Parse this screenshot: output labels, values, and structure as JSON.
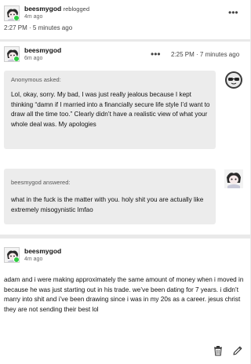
{
  "reblog_header": {
    "username": "beesmygod",
    "action": "reblogged",
    "relative_time": "4m ago",
    "timestamp": "2:27 PM · 5 minutes ago",
    "more_label": "•••"
  },
  "main_post": {
    "username": "beesmygod",
    "relative_time": "6m ago",
    "more_label": "•••",
    "timestamp": "2:25 PM · 7 minutes ago",
    "ask": {
      "asker": "Anonymous",
      "asked_label": "asked:",
      "text": "Lol, okay, sorry. My bad, I was just really jealous because I kept thinking “damn if I married into a financially secure life style I’d want to draw all the time too.” Clearly didn’t have a realistic view of what your whole deal was. My apologies"
    },
    "answer": {
      "answerer": "beesmygod",
      "answered_label": "answered:",
      "text": "what in the fuck is the matter with you. holy shit you are actually like extremely misogynistic lmfao"
    }
  },
  "reply_post": {
    "username": "beesmygod",
    "relative_time": "4m ago",
    "text": "adam and i were making approximately the same amount of money when i moved in because he was just starting out in his trade. we’ve been dating for 7 years. i didn’t marry into shit and i’ve been drawing since i was in my 20s as a career. jesus christ they are not sending their best lol"
  },
  "icons": {
    "delete": "trash-icon",
    "edit": "pencil-icon",
    "anon": "anonymous-sunglasses-icon",
    "avatar": "user-avatar"
  },
  "colors": {
    "bubble": "#ececec",
    "online_badge": "#2ecc40",
    "background": "#e9e9e9"
  }
}
